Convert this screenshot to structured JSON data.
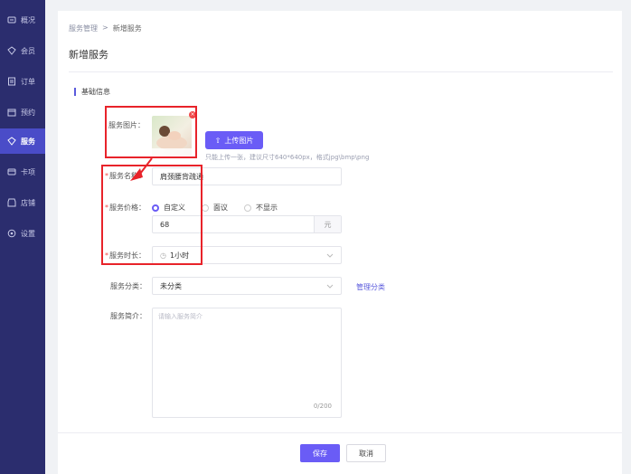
{
  "sidebar": {
    "items": [
      {
        "label": "概况",
        "icon": "dashboard-icon",
        "active": false
      },
      {
        "label": "会员",
        "icon": "member-icon",
        "active": false
      },
      {
        "label": "订单",
        "icon": "order-icon",
        "active": false
      },
      {
        "label": "预约",
        "icon": "appointment-icon",
        "active": false
      },
      {
        "label": "服务",
        "icon": "service-icon",
        "active": true
      },
      {
        "label": "卡项",
        "icon": "card-icon",
        "active": false
      },
      {
        "label": "店铺",
        "icon": "store-icon",
        "active": false
      },
      {
        "label": "设置",
        "icon": "settings-icon",
        "active": false
      }
    ]
  },
  "breadcrumb": {
    "parent": "服务管理",
    "separator": ">",
    "current": "新增服务"
  },
  "page": {
    "title": "新增服务"
  },
  "section": {
    "title": "基础信息"
  },
  "form": {
    "image": {
      "label": "服务图片：",
      "upload_label": "上传图片",
      "tip": "只能上传一张，建议尺寸640*640px，格式jpg\\bmp\\png"
    },
    "name": {
      "label": "服务名称：",
      "value": "肩颈腰背疏通"
    },
    "price": {
      "label": "服务价格：",
      "options": [
        "自定义",
        "面议",
        "不显示"
      ],
      "selected": "自定义",
      "value": "68",
      "unit": "元"
    },
    "duration": {
      "label": "服务时长：",
      "value": "1小时"
    },
    "category": {
      "label": "服务分类：",
      "value": "未分类",
      "manage_link": "管理分类"
    },
    "intro": {
      "label": "服务简介：",
      "placeholder": "请输入服务简介",
      "counter": "0/200"
    }
  },
  "footer": {
    "save_label": "保存",
    "cancel_label": "取消"
  },
  "colors": {
    "sidebar_bg": "#2b2d6e",
    "accent": "#6a5cf6",
    "annotation": "#e8232a"
  }
}
